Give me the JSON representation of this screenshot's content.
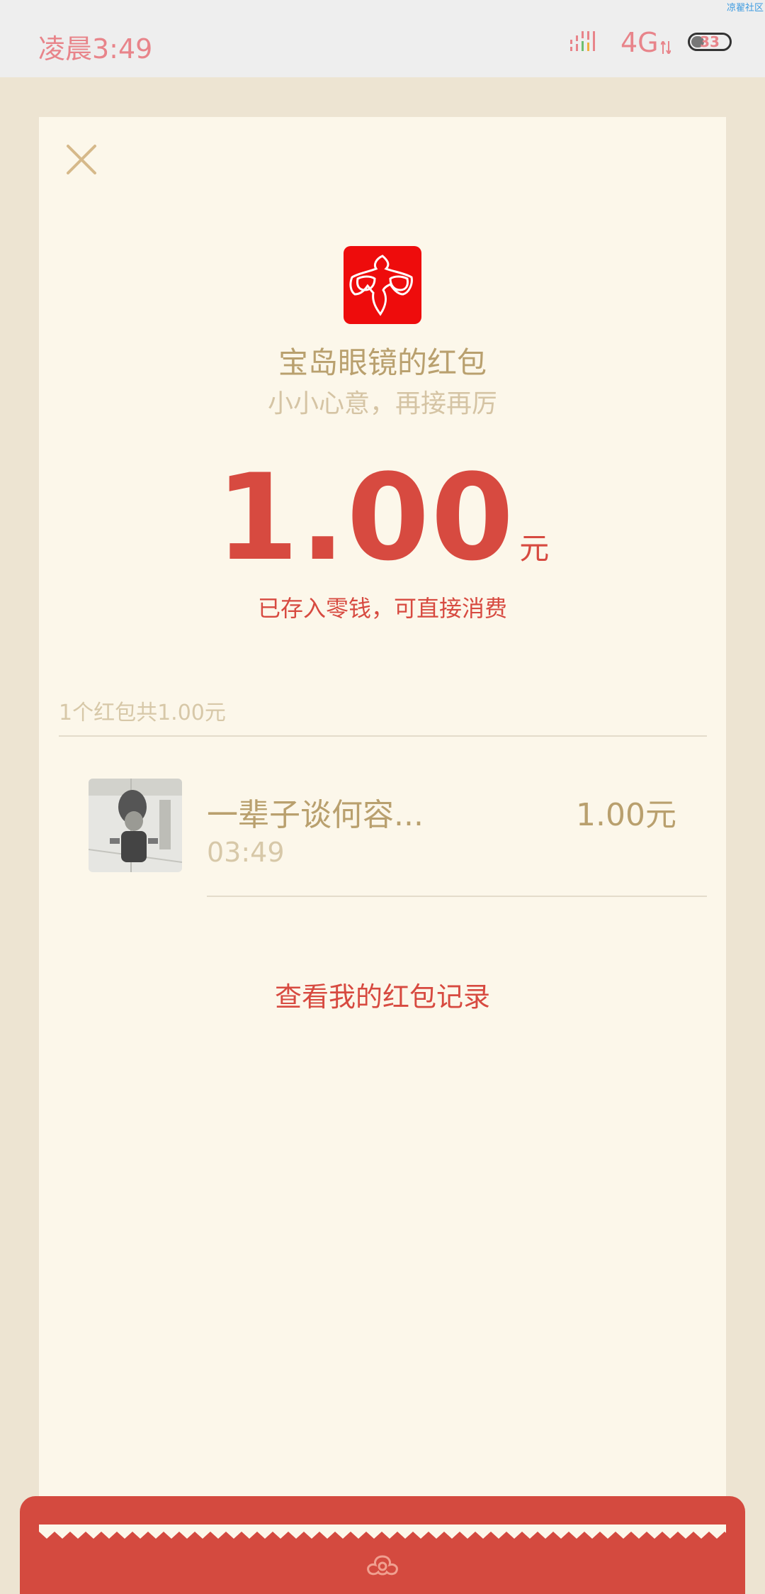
{
  "status_bar": {
    "time": "凌晨3:49",
    "network": "4G",
    "battery": "33",
    "watermark": "凉翟社区"
  },
  "red_packet": {
    "sender_title": "宝岛眼镜的红包",
    "greeting": "小小心意，再接再厉",
    "amount": "1.00",
    "amount_unit": "元",
    "stored_note": "已存入零钱，可直接消费",
    "summary": "1个红包共1.00元"
  },
  "records": [
    {
      "name": "一辈子谈何容...",
      "time": "03:49",
      "amount": "1.00元"
    }
  ],
  "history_link": "查看我的红包记录",
  "icons": {
    "close": "close-icon",
    "logo": "glasses-logo-icon",
    "emblem": "cloud-emblem-icon"
  },
  "colors": {
    "accent_red": "#d74a40",
    "gold_text": "#b9a06e",
    "card_bg": "#fcf7ea",
    "page_bg": "#ede4d2"
  }
}
